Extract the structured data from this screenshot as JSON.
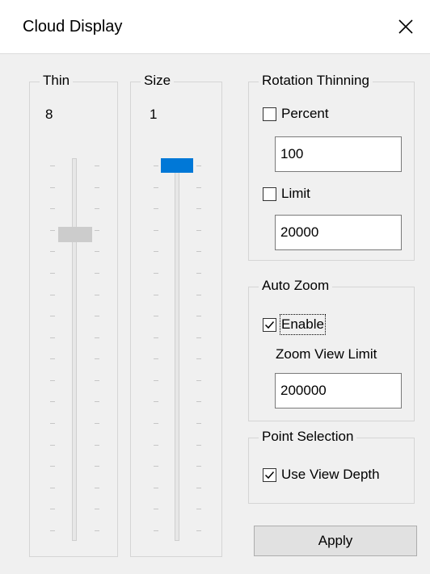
{
  "window": {
    "title": "Cloud Display",
    "close_icon": "close-icon"
  },
  "thin": {
    "label": "Thin",
    "value": "8",
    "slider_level": 0.19
  },
  "size": {
    "label": "Size",
    "value": "1",
    "slider_level": 0.0
  },
  "rotation_thinning": {
    "label": "Rotation Thinning",
    "percent": {
      "label": "Percent",
      "checked": false,
      "value": "100"
    },
    "limit": {
      "label": "Limit",
      "checked": false,
      "value": "20000"
    }
  },
  "auto_zoom": {
    "label": "Auto Zoom",
    "enable": {
      "label": "Enable",
      "checked": true
    },
    "zoom_view_limit_label": "Zoom View Limit",
    "zoom_view_limit_value": "200000"
  },
  "point_selection": {
    "label": "Point Selection",
    "use_view_depth": {
      "label": "Use View Depth",
      "checked": true
    }
  },
  "apply_label": "Apply",
  "colors": {
    "accent": "#0078d7",
    "thumb_disabled": "#cccccc",
    "background": "#f0f0f0"
  }
}
